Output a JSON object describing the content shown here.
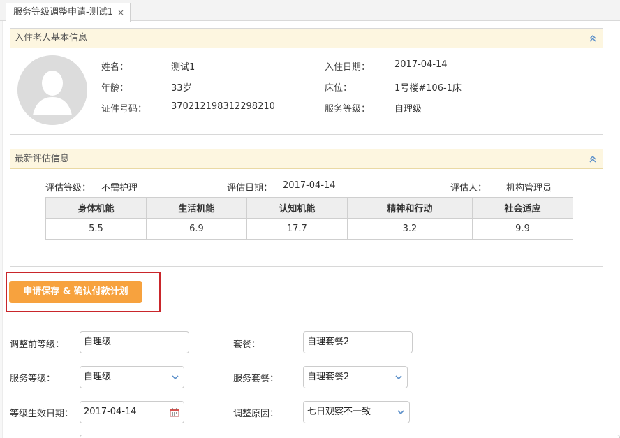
{
  "tab": {
    "title": "服务等级调整申请-测试1",
    "close": "×"
  },
  "resident_panel": {
    "title": "入住老人基本信息",
    "fields": {
      "name": {
        "label": "姓名：",
        "value": "测试1"
      },
      "age": {
        "label": "年龄：",
        "value": "33岁"
      },
      "id_number": {
        "label": "证件号码：",
        "value": "370212198312298210"
      },
      "checkin_date": {
        "label": "入住日期：",
        "value": "2017-04-14"
      },
      "bed": {
        "label": "床位：",
        "value": "1号楼#106-1床"
      },
      "service_level": {
        "label": "服务等级：",
        "value": "自理级"
      }
    }
  },
  "assessment_panel": {
    "title": "最新评估信息",
    "level": {
      "label": "评估等级：",
      "value": "不需护理"
    },
    "date": {
      "label": "评估日期：",
      "value": "2017-04-14"
    },
    "assessor": {
      "label": "评估人：",
      "value": "机构管理员"
    },
    "columns": [
      "身体机能",
      "生活机能",
      "认知机能",
      "精神和行动",
      "社会适应"
    ],
    "scores": [
      "5.5",
      "6.9",
      "17.7",
      "3.2",
      "9.9"
    ]
  },
  "actions": {
    "save_confirm": "申请保存 & 确认付款计划"
  },
  "form": {
    "prev_level": {
      "label": "调整前等级：",
      "value": "自理级"
    },
    "package": {
      "label": "套餐：",
      "value": "自理套餐2"
    },
    "service_level": {
      "label": "服务等级：",
      "value": "自理级"
    },
    "service_package": {
      "label": "服务套餐：",
      "value": "自理套餐2"
    },
    "effective_date": {
      "label": "等级生效日期：",
      "value": "2017-04-14"
    },
    "reason": {
      "label": "调整原因：",
      "value": "七日观察不一致"
    }
  },
  "colors": {
    "accent": "#f7a23e",
    "header_bg": "#fdf6e0",
    "highlight": "#c9262b",
    "icon_blue": "#5b8fc9"
  }
}
